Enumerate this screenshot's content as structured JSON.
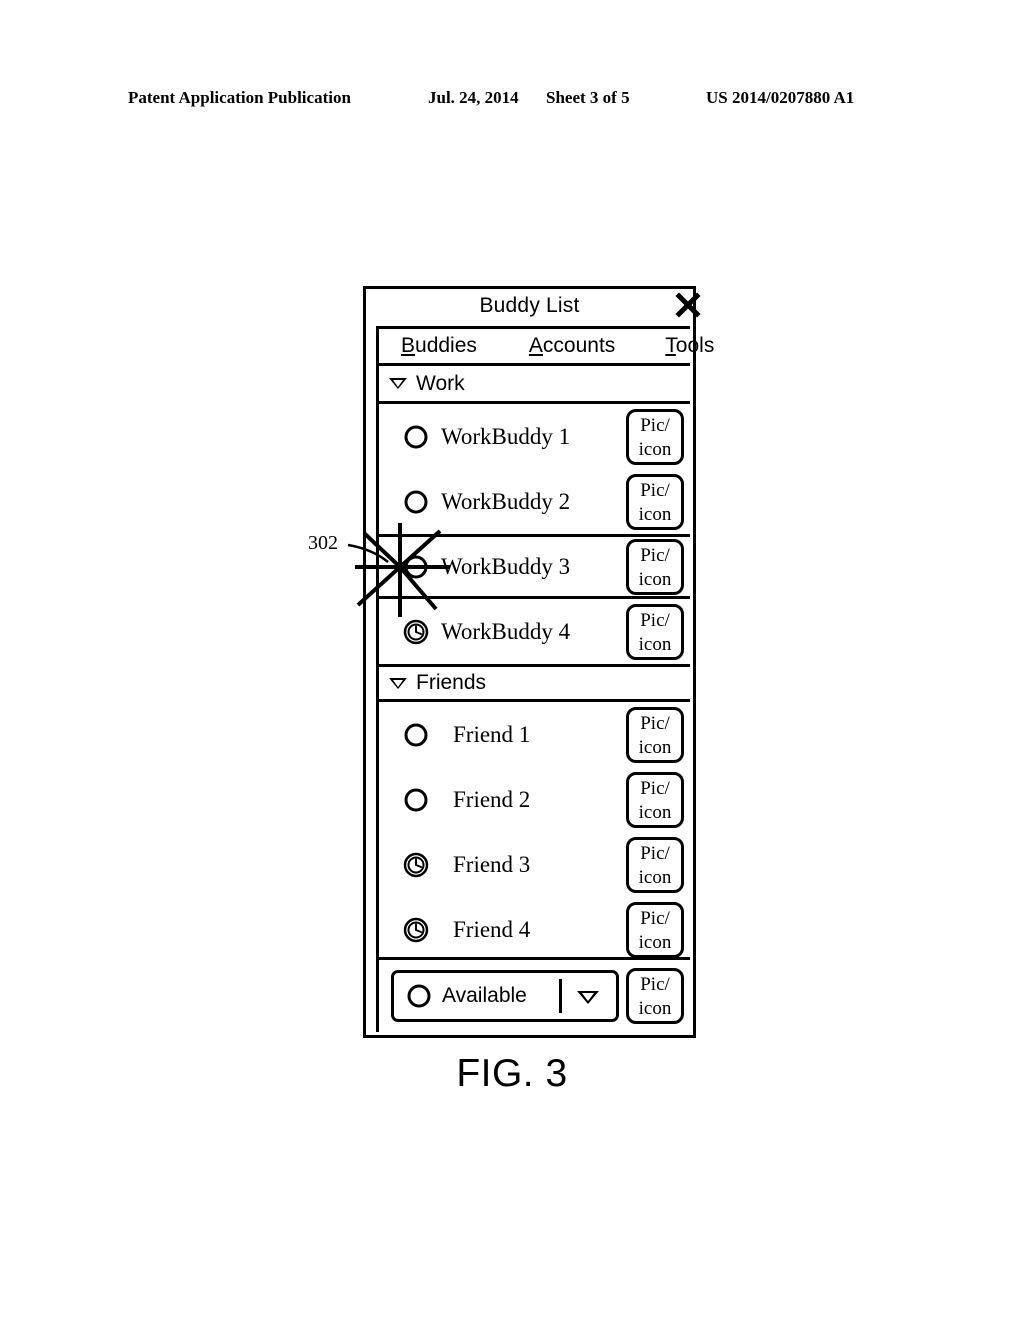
{
  "page_header": {
    "publication": "Patent Application Publication",
    "date": "Jul. 24, 2014",
    "sheet": "Sheet 3 of 5",
    "number": "US 2014/0207880 A1"
  },
  "figure": {
    "caption": "FIG. 3"
  },
  "window": {
    "title": "Buddy List",
    "close_icon": "close-x-icon"
  },
  "menu": {
    "items": [
      {
        "mnemonic": "B",
        "rest": "uddies"
      },
      {
        "mnemonic": "A",
        "rest": "ccounts"
      },
      {
        "mnemonic": "T",
        "rest": "ools"
      }
    ]
  },
  "groups": [
    {
      "label": "Work",
      "expanded": true,
      "toggle_icon": "triangle-down-icon",
      "rows": [
        {
          "name": "WorkBuddy 1",
          "status_icon": "circle-available-icon",
          "pic_line1": "Pic/",
          "pic_line2": "icon"
        },
        {
          "name": "WorkBuddy 2",
          "status_icon": "circle-available-icon",
          "pic_line1": "Pic/",
          "pic_line2": "icon"
        },
        {
          "name": "WorkBuddy 3",
          "status_icon": "circle-available-icon",
          "pic_line1": "Pic/",
          "pic_line2": "icon"
        },
        {
          "name": "WorkBuddy 4",
          "status_icon": "clock-away-icon",
          "pic_line1": "Pic/",
          "pic_line2": "icon"
        }
      ]
    },
    {
      "label": "Friends",
      "expanded": true,
      "toggle_icon": "triangle-down-icon",
      "rows": [
        {
          "name": "Friend 1",
          "status_icon": "circle-available-icon",
          "pic_line1": "Pic/",
          "pic_line2": "icon"
        },
        {
          "name": "Friend 2",
          "status_icon": "circle-available-icon",
          "pic_line1": "Pic/",
          "pic_line2": "icon"
        },
        {
          "name": "Friend 3",
          "status_icon": "clock-away-icon",
          "pic_line1": "Pic/",
          "pic_line2": "icon"
        },
        {
          "name": "Friend 4",
          "status_icon": "clock-away-icon",
          "pic_line1": "Pic/",
          "pic_line2": "icon"
        }
      ]
    }
  ],
  "status_selector": {
    "value": "Available",
    "status_icon": "circle-available-icon",
    "dropdown_icon": "triangle-down-icon",
    "pic_line1": "Pic/",
    "pic_line2": "icon"
  },
  "annotations": [
    {
      "number": "302",
      "target": "starburst-marker",
      "icon": "starburst-icon"
    }
  ]
}
